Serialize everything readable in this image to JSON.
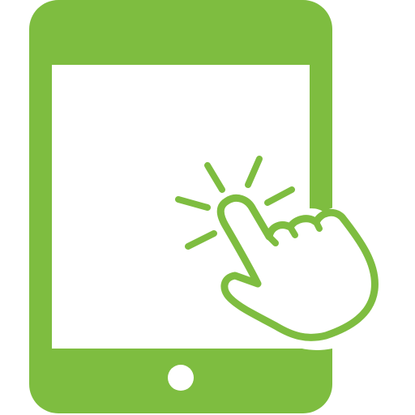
{
  "icon": {
    "name": "tablet-touch-icon",
    "colors": {
      "primary": "#7ebd40",
      "background": "#ffffff"
    }
  }
}
